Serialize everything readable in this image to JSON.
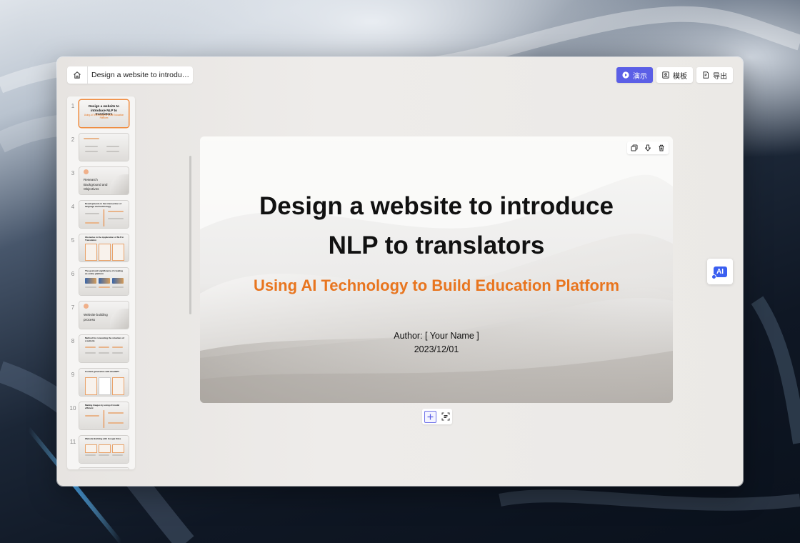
{
  "header": {
    "doc_title": "Design a website to introduc...",
    "present_label": "演示",
    "template_label": "模板",
    "export_label": "导出"
  },
  "slide": {
    "title_line1": "Design a website to introduce",
    "title_line2": "NLP to translators",
    "subtitle": "Using AI Technology to Build Education Platform",
    "author": "Author: [ Your Name ]",
    "date": "2023/12/01"
  },
  "thumbnails": [
    {
      "num": "1",
      "title": "Design a website to introduce NLP to translators",
      "sub": "Using AI Technology to Build Education Platform"
    },
    {
      "num": "2",
      "title": ""
    },
    {
      "num": "3",
      "title": "Research Background and Objectives"
    },
    {
      "num": "4",
      "title": "Developments in the intersection of language and technology"
    },
    {
      "num": "5",
      "title": "Obstacles in the Application of NLP in Translation"
    },
    {
      "num": "6",
      "title": "The goal and significance of creating an online platform"
    },
    {
      "num": "7",
      "title": "Website building process"
    },
    {
      "num": "8",
      "title": "Method for conceiving the structure of a website"
    },
    {
      "num": "9",
      "title": "Content generation with ChatGPT"
    },
    {
      "num": "10",
      "title": "Making Images by using AI model efficient"
    },
    {
      "num": "11",
      "title": "Website Building with Google Sites"
    }
  ],
  "ai_button": {
    "label": "AI"
  },
  "colors": {
    "accent": "#5b5fe6",
    "subtitle": "#e8751f",
    "ai": "#3b5ff0"
  }
}
